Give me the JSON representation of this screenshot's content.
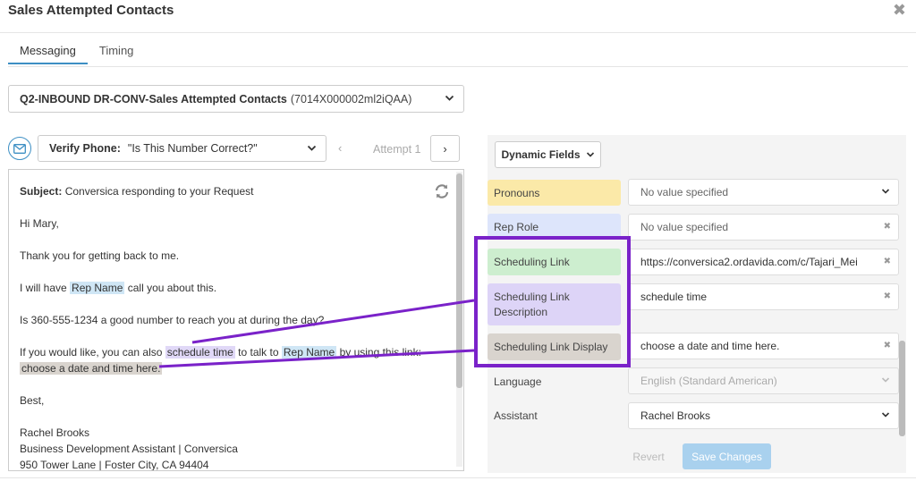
{
  "modal": {
    "title": "Sales Attempted Contacts",
    "close_icon": "✖"
  },
  "tabs": [
    {
      "label": "Messaging",
      "active": true
    },
    {
      "label": "Timing",
      "active": false
    }
  ],
  "campaign": {
    "name": "Q2-INBOUND DR-CONV-Sales Attempted Contacts",
    "id": "(7014X000002ml2iQAA)"
  },
  "message": {
    "type_label": "Verify Phone:",
    "type_value": "\"Is This Number Correct?\"",
    "attempt_label": "Attempt 1",
    "prev_label": "‹",
    "next_label": "›"
  },
  "email": {
    "subject_label": "Subject:",
    "subject_value": "Conversica responding to your Request",
    "greeting": "Hi Mary,",
    "line1": "Thank you for getting back to me.",
    "line2_pre": "I will have",
    "rep_name": "Rep Name",
    "line2_post": "call you about this.",
    "line3": "Is 360-555-1234 a good number to reach you at during the day?",
    "line4_pre": "If you would like, you can also",
    "schedule_time": "schedule time",
    "line4_mid": "to talk to",
    "rep_name_2": "Rep Name",
    "line4_post": "by using this link:",
    "choose_date": "choose a date and time here.",
    "closing": "Best,",
    "sig_name": "Rachel Brooks",
    "sig_title": "Business Development Assistant | Conversica",
    "sig_address": "950 Tower Lane | Foster City, CA 94404"
  },
  "dynamic_fields": {
    "button_label": "Dynamic Fields",
    "fields": [
      {
        "label": "Pronouns",
        "value": "No value specified",
        "control": "dropdown",
        "color": "#fbe9a8"
      },
      {
        "label": "Rep Role",
        "value": "No value specified",
        "control": "clear",
        "color": "#dde5fb"
      },
      {
        "label": "Scheduling Link",
        "value": "https://conversica2.ordavida.com/c/Tajari_Mei",
        "control": "clear",
        "color": "#cdeecf"
      },
      {
        "label": "Scheduling Link Description",
        "value": "schedule time",
        "control": "clear",
        "color": "#ddd4f7"
      },
      {
        "label": "Scheduling Link Display",
        "value": "choose a date and time here.",
        "control": "clear",
        "color": "#d9d4ce"
      },
      {
        "label": "Language",
        "value": "English (Standard American)",
        "control": "dropdown-disabled",
        "color": ""
      },
      {
        "label": "Assistant",
        "value": "Rachel Brooks",
        "control": "dropdown",
        "color": ""
      }
    ]
  },
  "actions": {
    "revert_label": "Revert",
    "save_label": "Save Changes"
  },
  "colors": {
    "accent": "#3d8fc4",
    "highlight_box": "#7a22c9",
    "save_button": "#a9d1ee"
  }
}
